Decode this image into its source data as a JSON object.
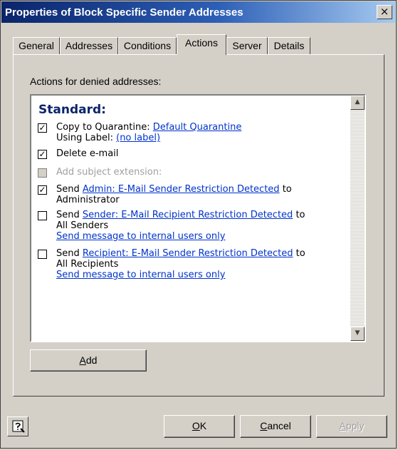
{
  "window": {
    "title": "Properties of Block Specific Sender Addresses",
    "close_glyph": "×"
  },
  "tabs": [
    {
      "label": "General"
    },
    {
      "label": "Addresses"
    },
    {
      "label": "Conditions"
    },
    {
      "label": "Actions",
      "active": true
    },
    {
      "label": "Server"
    },
    {
      "label": "Details"
    }
  ],
  "actions_label": "Actions for denied addresses:",
  "list": {
    "heading": "Standard:",
    "items": [
      {
        "checked": true,
        "enabled": true,
        "prefix": "Copy to Quarantine:",
        "link": "Default Quarantine",
        "line2_prefix": "Using Label:",
        "line2_link": "(no label)"
      },
      {
        "checked": true,
        "enabled": true,
        "text": "Delete e-mail"
      },
      {
        "checked": false,
        "enabled": false,
        "text": "Add subject extension:"
      },
      {
        "checked": true,
        "enabled": true,
        "prefix": "Send",
        "link": "Admin: E-Mail Sender Restriction Detected",
        "suffix": "to",
        "line2": "Administrator"
      },
      {
        "checked": false,
        "enabled": true,
        "prefix": "Send",
        "link": "Sender: E-Mail Recipient Restriction Detected",
        "suffix": "to",
        "line2": "All Senders",
        "line3_link": "Send message to internal users only"
      },
      {
        "checked": false,
        "enabled": true,
        "prefix": "Send",
        "link": "Recipient: E-Mail Sender Restriction Detected",
        "suffix": "to",
        "line2": "All Recipients",
        "line3_link": "Send message to internal users only"
      }
    ],
    "check_glyph": "✓"
  },
  "buttons": {
    "add": "Add",
    "ok": "OK",
    "cancel": "Cancel",
    "apply": "Apply"
  },
  "scroll": {
    "up_glyph": "▲",
    "down_glyph": "▼"
  },
  "icons": {
    "help": "help-icon"
  },
  "colors": {
    "link": "#0033cc",
    "heading": "#0a246a",
    "title_bar": "#0a246a"
  }
}
